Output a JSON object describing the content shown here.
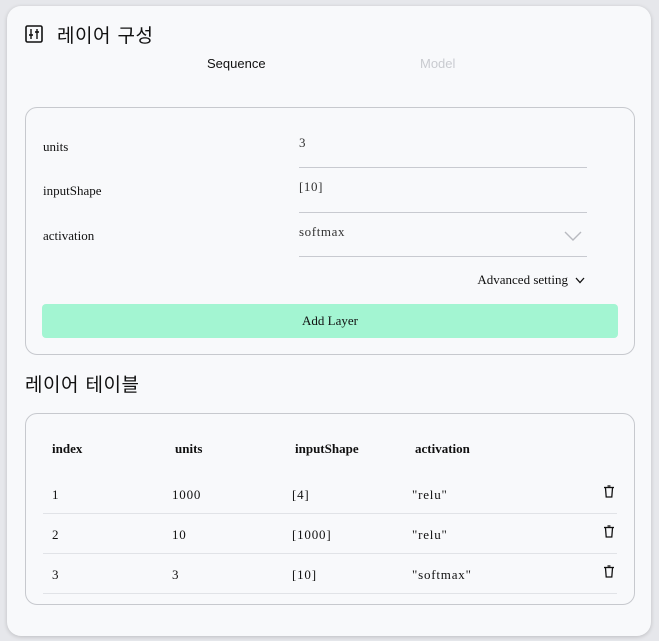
{
  "header": {
    "icon": "sliders-icon",
    "title": "레이어 구성"
  },
  "tabs": [
    {
      "label": "Sequence",
      "active": true
    },
    {
      "label": "Model",
      "active": false
    }
  ],
  "form": {
    "fields": [
      {
        "label": "units",
        "value": "3"
      },
      {
        "label": "inputShape",
        "value": "[10]"
      },
      {
        "label": "activation",
        "value": "softmax",
        "type": "select"
      }
    ],
    "advanced_label": "Advanced setting",
    "add_button_label": "Add Layer"
  },
  "table": {
    "title": "레이어 테이블",
    "columns": [
      "index",
      "units",
      "inputShape",
      "activation"
    ],
    "rows": [
      {
        "index": "1",
        "units": "1000",
        "inputShape": "[4]",
        "activation": "\"relu\""
      },
      {
        "index": "2",
        "units": "10",
        "inputShape": "[1000]",
        "activation": "\"relu\""
      },
      {
        "index": "3",
        "units": "3",
        "inputShape": "[10]",
        "activation": "\"softmax\""
      }
    ]
  },
  "colors": {
    "accent_button": "#a3f5d2",
    "inactive_tab": "#c9cbd0"
  }
}
